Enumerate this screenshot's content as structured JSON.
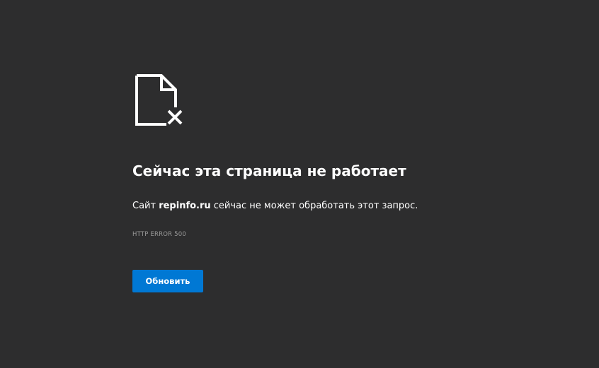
{
  "error": {
    "icon": "broken-file-icon",
    "title": "Сейчас эта страница не работает",
    "message_prefix": "Сайт ",
    "site": "repinfo.ru",
    "message_suffix": " сейчас не может обработать этот запрос.",
    "code": "HTTP ERROR 500",
    "reload_label": "Обновить"
  },
  "colors": {
    "background": "#2d2d2e",
    "text": "#ffffff",
    "code_text": "#9a9a9a",
    "accent": "#0078d4"
  }
}
